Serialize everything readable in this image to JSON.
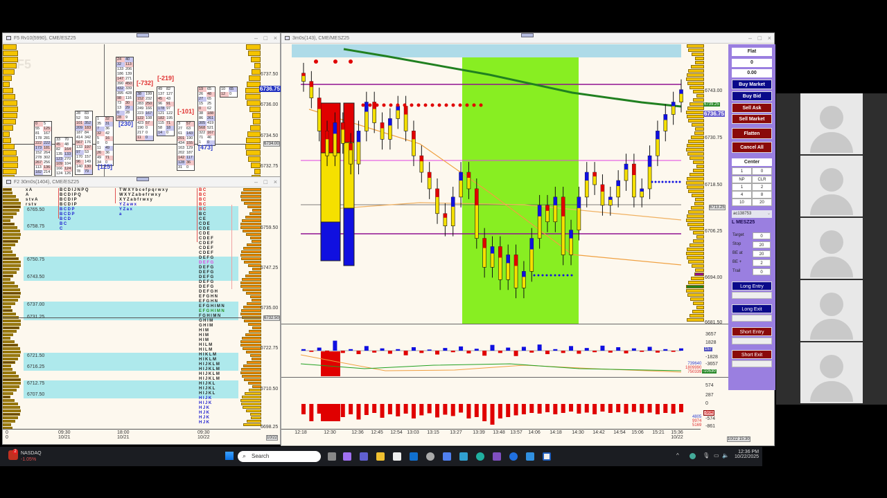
{
  "footprint_window": {
    "title": "F5 Rv10(5990), CME/ESZ25",
    "watermark": "F5",
    "price_ticks": [
      "6737.50",
      "6736.00",
      "6734.50",
      "6732.75"
    ],
    "current_price": "6736.75",
    "crosshair_price": "6734.00",
    "deltas": [
      {
        "text": "[-732]",
        "color": "#e03030"
      },
      {
        "text": "[-219]",
        "color": "#e03030"
      },
      {
        "text": "[-101]",
        "color": "#e03030"
      },
      {
        "text": "[230]",
        "color": "#3040d0"
      },
      {
        "text": "[125]",
        "color": "#3040d0"
      },
      {
        "text": "[473]",
        "color": "#3040d0"
      }
    ],
    "boxes": [
      {
        "rows": [
          [
            "0",
            "5"
          ],
          [
            "55",
            "125"
          ],
          [
            "81",
            "167"
          ],
          [
            "178",
            "281"
          ],
          [
            "222",
            "222"
          ],
          [
            "173",
            "181"
          ],
          [
            "152",
            "264"
          ],
          [
            "278",
            "302"
          ],
          [
            "267",
            "256"
          ],
          [
            "113",
            "136"
          ],
          [
            "182",
            "214"
          ]
        ]
      },
      {
        "rows": [
          [
            "33",
            "70"
          ],
          [
            "45",
            "48"
          ],
          [
            "82",
            "164"
          ],
          [
            "135",
            "133"
          ],
          [
            "123",
            "270"
          ],
          [
            "109",
            "104"
          ],
          [
            "166",
            "124"
          ],
          [
            "124",
            "126"
          ]
        ]
      },
      {
        "rows": [
          [
            "28",
            "83"
          ],
          [
            "52",
            "59"
          ],
          [
            "101",
            "352"
          ],
          [
            "209",
            "183"
          ],
          [
            "187",
            "84"
          ],
          [
            "414",
            "342"
          ],
          [
            "567",
            "176"
          ],
          [
            "133",
            "197"
          ],
          [
            "97",
            "53"
          ],
          [
            "170",
            "157"
          ],
          [
            "96",
            "149"
          ],
          [
            "140",
            "130"
          ],
          [
            "78",
            "79"
          ]
        ]
      },
      {
        "rows": [
          [
            "1",
            "32"
          ],
          [
            "35",
            "31"
          ],
          [
            "7",
            "36"
          ],
          [
            "32",
            "42"
          ],
          [
            "5",
            "16"
          ],
          [
            "0",
            "0"
          ],
          [
            "11",
            "49"
          ],
          [
            "26",
            "36"
          ],
          [
            "49",
            "71"
          ],
          [
            "34",
            "0"
          ]
        ]
      },
      {
        "rows": [
          [
            "24",
            "40"
          ],
          [
            "32",
            "113"
          ],
          [
            "133",
            "206"
          ],
          [
            "186",
            "139"
          ],
          [
            "147",
            "271"
          ],
          [
            "390",
            "450"
          ],
          [
            "432",
            "339"
          ],
          [
            "395",
            "428"
          ],
          [
            "98",
            "116"
          ],
          [
            "73",
            "30"
          ],
          [
            "13",
            "29"
          ],
          [
            "0",
            "28"
          ],
          [
            "28",
            "9"
          ]
        ]
      },
      {
        "rows": [
          [
            "38",
            "199"
          ],
          [
            "152",
            "232"
          ],
          [
            "283",
            "250"
          ],
          [
            "249",
            "166"
          ],
          [
            "223",
            "167"
          ],
          [
            "122",
            "108"
          ],
          [
            "423",
            "57"
          ],
          [
            "190",
            "0"
          ],
          [
            "217",
            "0"
          ],
          [
            "11",
            "0"
          ]
        ]
      },
      {
        "rows": [
          [
            "49",
            "82"
          ],
          [
            "137",
            "127"
          ],
          [
            "45",
            "43"
          ],
          [
            "96",
            "91"
          ],
          [
            "178",
            "97"
          ],
          [
            "121",
            "122"
          ],
          [
            "182",
            "195"
          ],
          [
            "115",
            "71"
          ],
          [
            "58",
            "18"
          ],
          [
            "14",
            "0"
          ]
        ]
      },
      {
        "rows": [
          [
            "3",
            "57"
          ],
          [
            "27",
            "63"
          ],
          [
            "61",
            "143"
          ],
          [
            "201",
            "190"
          ],
          [
            "434",
            "155"
          ],
          [
            "163",
            "129"
          ],
          [
            "202",
            "187"
          ],
          [
            "142",
            "117"
          ],
          [
            "128",
            "36"
          ],
          [
            "31",
            "0"
          ]
        ]
      },
      {
        "rows": [
          [
            "19",
            "65"
          ],
          [
            "26",
            "48"
          ],
          [
            "27",
            "65"
          ],
          [
            "15",
            "25"
          ],
          [
            "0",
            "62"
          ],
          [
            "38",
            "188"
          ],
          [
            "86",
            "261"
          ],
          [
            "305",
            "419"
          ],
          [
            "568",
            "521"
          ],
          [
            "322",
            "167"
          ],
          [
            "71",
            "46"
          ],
          [
            "1",
            "0"
          ]
        ]
      },
      {
        "rows": [
          [
            "10",
            "65"
          ],
          [
            "12",
            "0"
          ]
        ]
      }
    ]
  },
  "tpo_window": {
    "title": "F2 30m0s(1404), CME/ESZ25",
    "price_ticks": [
      "6759.50",
      "6747.25",
      "6735.00",
      "6722.75",
      "6710.50",
      "6698.25"
    ],
    "crosshair_price": "6732.50",
    "level_labels": [
      "6765.50",
      "6758.75",
      "6750.75",
      "6743.50",
      "6737.00",
      "6731.25",
      "6721.50",
      "6716.25",
      "6712.75",
      "6707.50"
    ],
    "col_a": [
      "xA",
      "A",
      "stvA",
      "rstv"
    ],
    "col_b": [
      "BCDIJNPQ",
      "BCDIPQ",
      "BCDIP",
      "BCDIP",
      "BCDP",
      "BCDP",
      "BCD",
      "BC",
      "C"
    ],
    "col_c": [
      "TWXYbcefpqrwxy",
      "WXYZabefrwxy",
      "XYZabfrwxy",
      "YZawx",
      "YZax",
      "a"
    ],
    "col_d": [
      "BC",
      "BC",
      "BC",
      "BC",
      "BC",
      "BC",
      "CE",
      "CDE",
      "CDE",
      "CDE",
      "CDEF",
      "CDEF",
      "CDEF",
      "CDEF",
      "DEFG",
      "DEFG",
      "DEFG",
      "DEFG",
      "DEFG",
      "DEFG",
      "DEFG",
      "DEFGH",
      "EFGHN",
      "EFGHN",
      "EFGHIMN",
      "EFGHIMN",
      "FGHIMN",
      "GHIM",
      "GHIM",
      "HIM",
      "HIM",
      "HIM",
      "HILM",
      "HILM",
      "HIKLM",
      "HIKLM",
      "HIJKLM",
      "HIJKLM",
      "HIJKLM",
      "HIJKLM",
      "HIJKL",
      "HIJKL",
      "HIJKL",
      "HIJK",
      "HIJK",
      "HJK",
      "HJK",
      "HJK",
      "HJK"
    ],
    "time_ticks": [
      {
        "t": "0",
        "d": "0"
      },
      {
        "t": "09:30",
        "d": "10/21"
      },
      {
        "t": "18:00",
        "d": "10/21"
      },
      {
        "t": "09:30",
        "d": "10/22"
      }
    ],
    "date_box": "10/22"
  },
  "chart_window": {
    "title": "3m0s(143), CME/MESZ25",
    "price_ticks": [
      "6743.00",
      "6730.75",
      "6718.50",
      "6706.25",
      "6694.00",
      "6681.50"
    ],
    "green_price": "6739.25",
    "current_price": "6736.75",
    "crosshair_price": "6713.25",
    "ind1_ticks": [
      "3657",
      "1828",
      "-1828",
      "-3657"
    ],
    "ind1_box": "157",
    "ind1_green": "-10530",
    "ind1_values": [
      {
        "v": "739640",
        "c": "#3040d0"
      },
      {
        "v": "1809990",
        "c": "#e03030"
      },
      {
        "v": "750339",
        "c": "#e03030"
      }
    ],
    "ind2_ticks": [
      "574",
      "287",
      "0",
      "-574",
      "-861"
    ],
    "ind2_box": "-504",
    "ind2_values": [
      {
        "v": "4805",
        "c": "#3040d0"
      },
      {
        "v": "9974",
        "c": "#e03030"
      },
      {
        "v": "5169",
        "c": "#e03030"
      }
    ],
    "time_ticks": [
      "12:18",
      "12:30",
      "12:36",
      "12:45",
      "12:54",
      "13:03",
      "13:15",
      "13:27",
      "13:39",
      "13:48",
      "13:57",
      "14:06",
      "14:18",
      "14:30",
      "14:42",
      "14:54",
      "15:06",
      "15:21",
      "15:36"
    ],
    "last_date": "10/22",
    "date_box": "10/22 15:30"
  },
  "chart_data": {
    "type": "candlestick",
    "ylim": [
      6681.5,
      6749
    ],
    "closes": [
      6740,
      6736,
      6728,
      6722,
      6730,
      6725,
      6720,
      6728,
      6735,
      6730,
      6726,
      6731,
      6734,
      6728,
      6722,
      6718,
      6714,
      6708,
      6705,
      6712,
      6718,
      6714,
      6702,
      6695,
      6700,
      6692,
      6698,
      6690,
      6694,
      6702,
      6710,
      6706,
      6712,
      6698,
      6704,
      6712,
      6718,
      6715,
      6710,
      6712,
      6716,
      6720,
      6712,
      6714,
      6722,
      6728,
      6732,
      6735,
      6738
    ],
    "volume_delta": [
      40,
      -30,
      80,
      -200,
      260,
      -60,
      40,
      -90,
      120,
      -50,
      60,
      -80,
      40,
      -120,
      90,
      -60,
      30,
      -100,
      70,
      -40,
      110,
      -70,
      50,
      -130,
      150,
      -60,
      80,
      -140,
      100,
      -50,
      160,
      -90,
      40,
      -60,
      120,
      -80,
      70,
      -40,
      130,
      -50,
      90,
      -70,
      60,
      -30,
      100,
      -50,
      40,
      -30,
      60
    ],
    "histogram": [
      -300,
      -500,
      -280,
      -420,
      -260,
      -380,
      -300,
      -450,
      -320,
      -260,
      -400,
      -300,
      -360,
      -280,
      -420,
      -330,
      -270,
      -390,
      -310,
      -350,
      -250,
      -420,
      -380,
      -500,
      -600,
      -420,
      -380,
      -330,
      -300,
      -260,
      -280,
      -240,
      -300,
      -260,
      -220,
      -280,
      -250,
      -300,
      -220,
      -260,
      -240,
      -280,
      -230,
      -270,
      -250,
      -300,
      -260,
      -280,
      -240
    ]
  },
  "control_panel": {
    "position": "Flat",
    "qty": "0",
    "pnl": "0.00",
    "buy_market": "Buy Market",
    "buy_bid": "Buy Bid",
    "sell_ask": "Sell Ask",
    "sell_market": "Sell Market",
    "flatten": "Flatten",
    "cancel_all": "Cancel All",
    "center": "Center",
    "qty_spin": "1",
    "qty_right": "0",
    "grid": [
      "NP",
      "CLR",
      "1",
      "2",
      "4",
      "8",
      "10",
      "20"
    ],
    "account": "ac138753",
    "instrument": "L MESZ25",
    "params": [
      {
        "label": "Target",
        "value": "0"
      },
      {
        "label": "Stop",
        "value": "20"
      },
      {
        "label": "BE at",
        "value": "20"
      },
      {
        "label": "BE +",
        "value": "2"
      },
      {
        "label": "Trail",
        "value": "0"
      }
    ],
    "long_entry": "Long Entry",
    "long_exit": "Long Exit",
    "short_entry": "Short Entry",
    "short_exit": "Short Exit"
  },
  "taskbar": {
    "ticker": "NASDAQ",
    "change": "-1.05%",
    "badge": "2",
    "search": "Search",
    "time": "12:36 PM",
    "date": "10/22/2025"
  }
}
